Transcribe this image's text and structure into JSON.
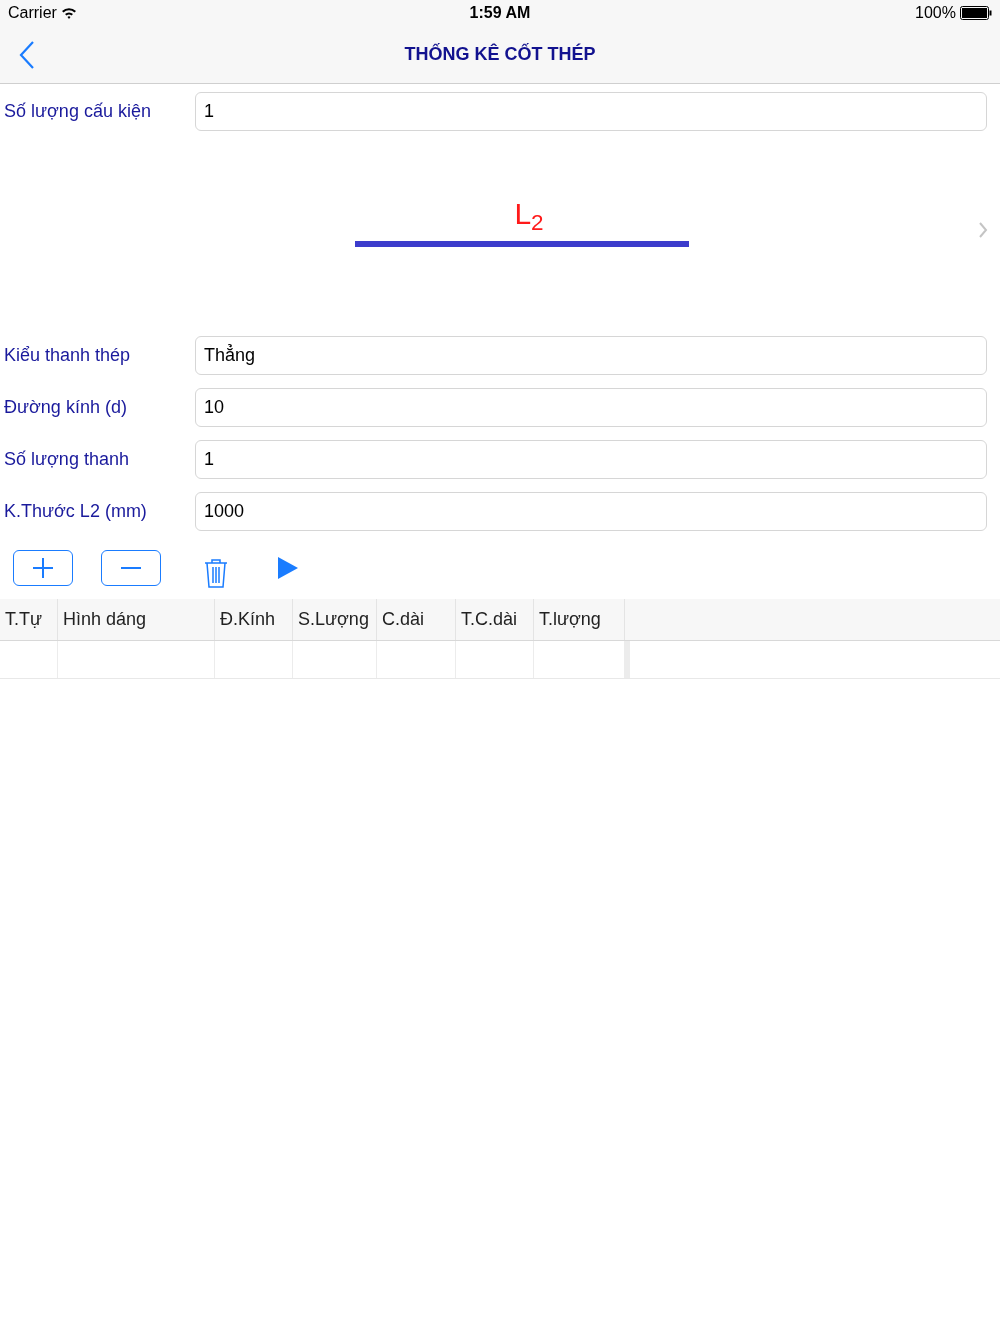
{
  "status_bar": {
    "carrier": "Carrier",
    "time": "1:59 AM",
    "battery": "100%"
  },
  "nav": {
    "title": "THỐNG KÊ CỐT THÉP"
  },
  "top_field": {
    "label": "Số lượng cấu kiện",
    "value": "1"
  },
  "diagram": {
    "label": "L$_{2}$"
  },
  "fields": [
    {
      "label": "Kiểu thanh thép",
      "value": "Thẳng"
    },
    {
      "label": "Đường kính (d)",
      "value": "10"
    },
    {
      "label": "Số lượng thanh",
      "value": "1"
    },
    {
      "label": "K.Thước L2 (mm)",
      "value": "1000"
    }
  ],
  "table": {
    "columns": [
      "T.Tự",
      "Hình dáng",
      "Đ.Kính",
      "S.Lượng",
      "C.dài",
      "T.C.dài",
      "T.lượng"
    ]
  }
}
